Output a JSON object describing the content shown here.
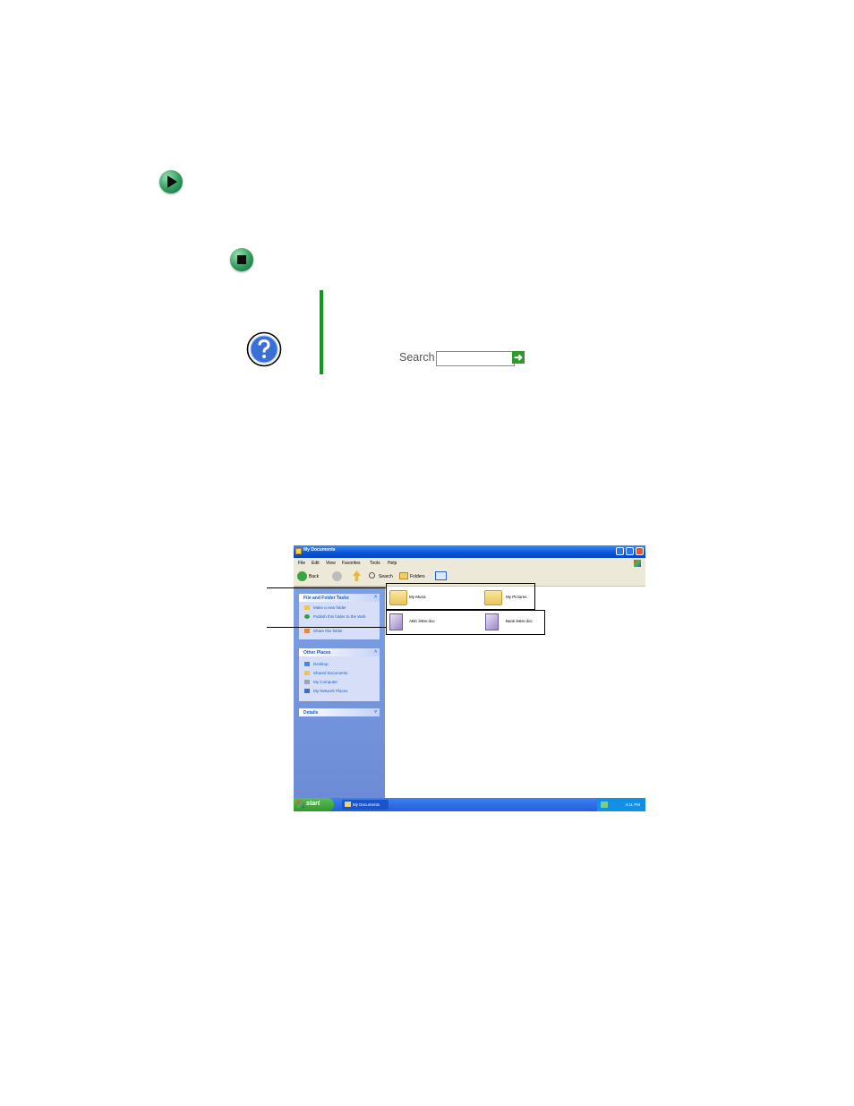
{
  "help": {
    "search_label": "Search",
    "search_value": "",
    "search_go_glyph": "➜"
  },
  "screenshot": {
    "title": "My Documents",
    "menu": [
      "File",
      "Edit",
      "View",
      "Favorites",
      "Tools",
      "Help"
    ],
    "toolbar": {
      "back": "Back",
      "search": "Search",
      "folders": "Folders"
    },
    "tasks_panel": {
      "header": "File and Folder Tasks",
      "links": [
        "Make a new folder",
        "Publish this folder to the Web",
        "Share this folder"
      ]
    },
    "places_panel": {
      "header": "Other Places",
      "links": [
        "Desktop",
        "Shared Documents",
        "My Computer",
        "My Network Places"
      ]
    },
    "details_panel": {
      "header": "Details"
    },
    "folders": [
      "My Music",
      "My Pictures"
    ],
    "documents": [
      "ABC letter.doc",
      "Bank letter.doc"
    ],
    "taskbar": {
      "start": "start",
      "task": "My Documents",
      "clock": "4:11 PM"
    }
  }
}
